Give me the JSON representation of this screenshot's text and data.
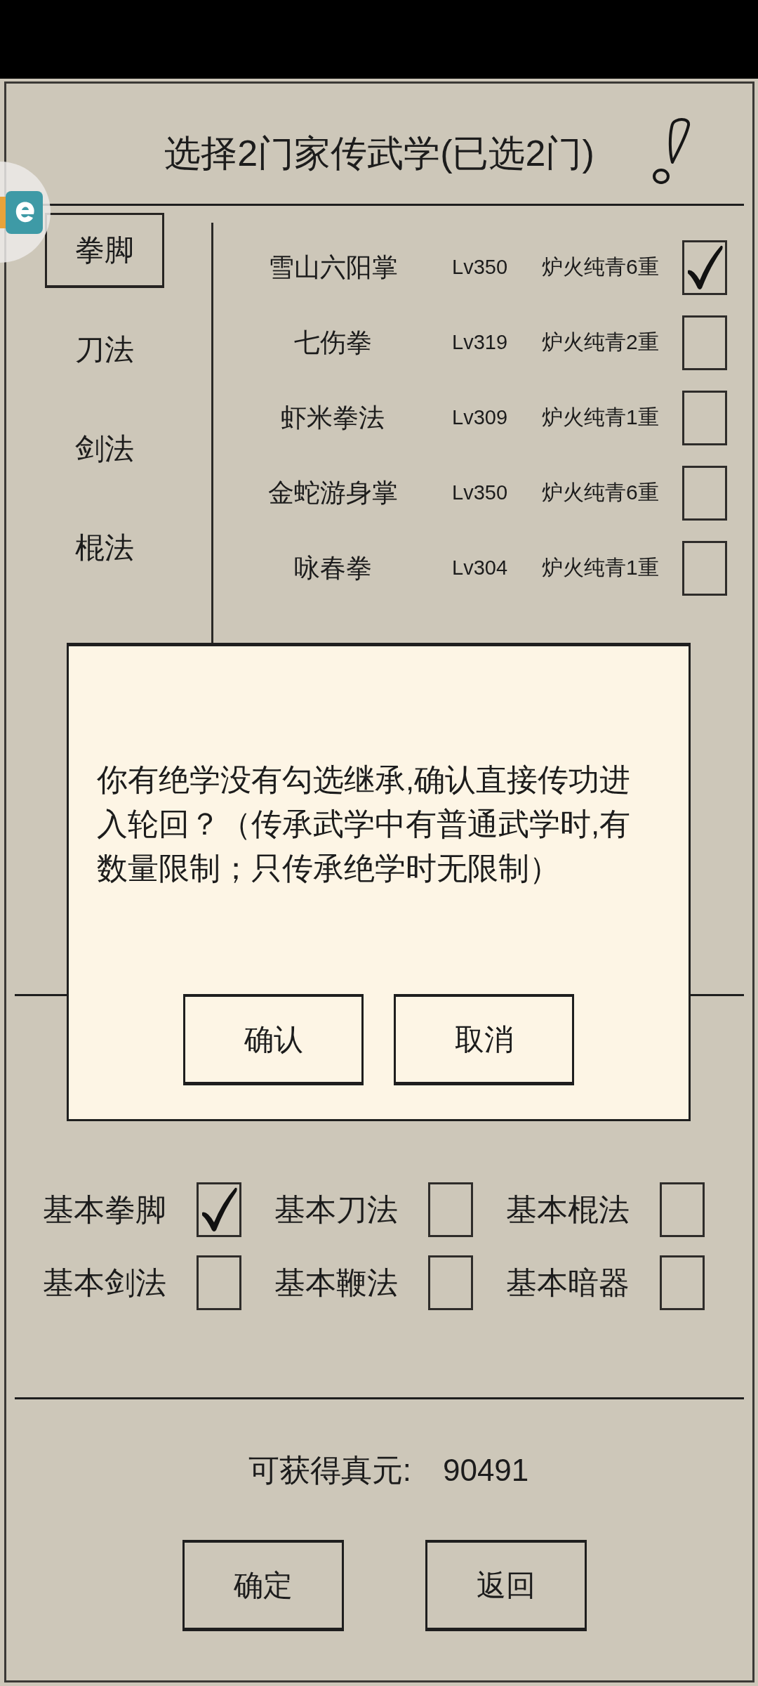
{
  "title": "选择2门家传武学(已选2门)",
  "tabs": [
    {
      "label": "拳脚",
      "selected": true
    },
    {
      "label": "刀法",
      "selected": false
    },
    {
      "label": "剑法",
      "selected": false
    },
    {
      "label": "棍法",
      "selected": false
    }
  ],
  "skills": [
    {
      "name": "雪山六阳掌",
      "grade": "Lv350",
      "realm": "炉火纯青6重",
      "checked": true
    },
    {
      "name": "七伤拳",
      "grade": "Lv319",
      "realm": "炉火纯青2重",
      "checked": false
    },
    {
      "name": "虾米拳法",
      "grade": "Lv309",
      "realm": "炉火纯青1重",
      "checked": false
    },
    {
      "name": "金蛇游身掌",
      "grade": "Lv350",
      "realm": "炉火纯青6重",
      "checked": false
    },
    {
      "name": "咏春拳",
      "grade": "Lv304",
      "realm": "炉火纯青1重",
      "checked": false
    }
  ],
  "basic_skills": [
    {
      "name": "基本拳脚",
      "checked": true
    },
    {
      "name": "基本刀法",
      "checked": false
    },
    {
      "name": "基本棍法",
      "checked": false
    },
    {
      "name": "基本剑法",
      "checked": false
    },
    {
      "name": "基本鞭法",
      "checked": false
    },
    {
      "name": "基本暗器",
      "checked": false
    }
  ],
  "reward": {
    "label": "可获得真元:",
    "value": "90491"
  },
  "buttons": [
    "确定",
    "返回"
  ],
  "dialog": {
    "message": "你有绝学没有勾选继承,确认直接传功进入轮回？（传承武学中有普通武学时,有数量限制；只传承绝学时无限制）",
    "buttons": [
      "确认",
      "取消"
    ]
  }
}
